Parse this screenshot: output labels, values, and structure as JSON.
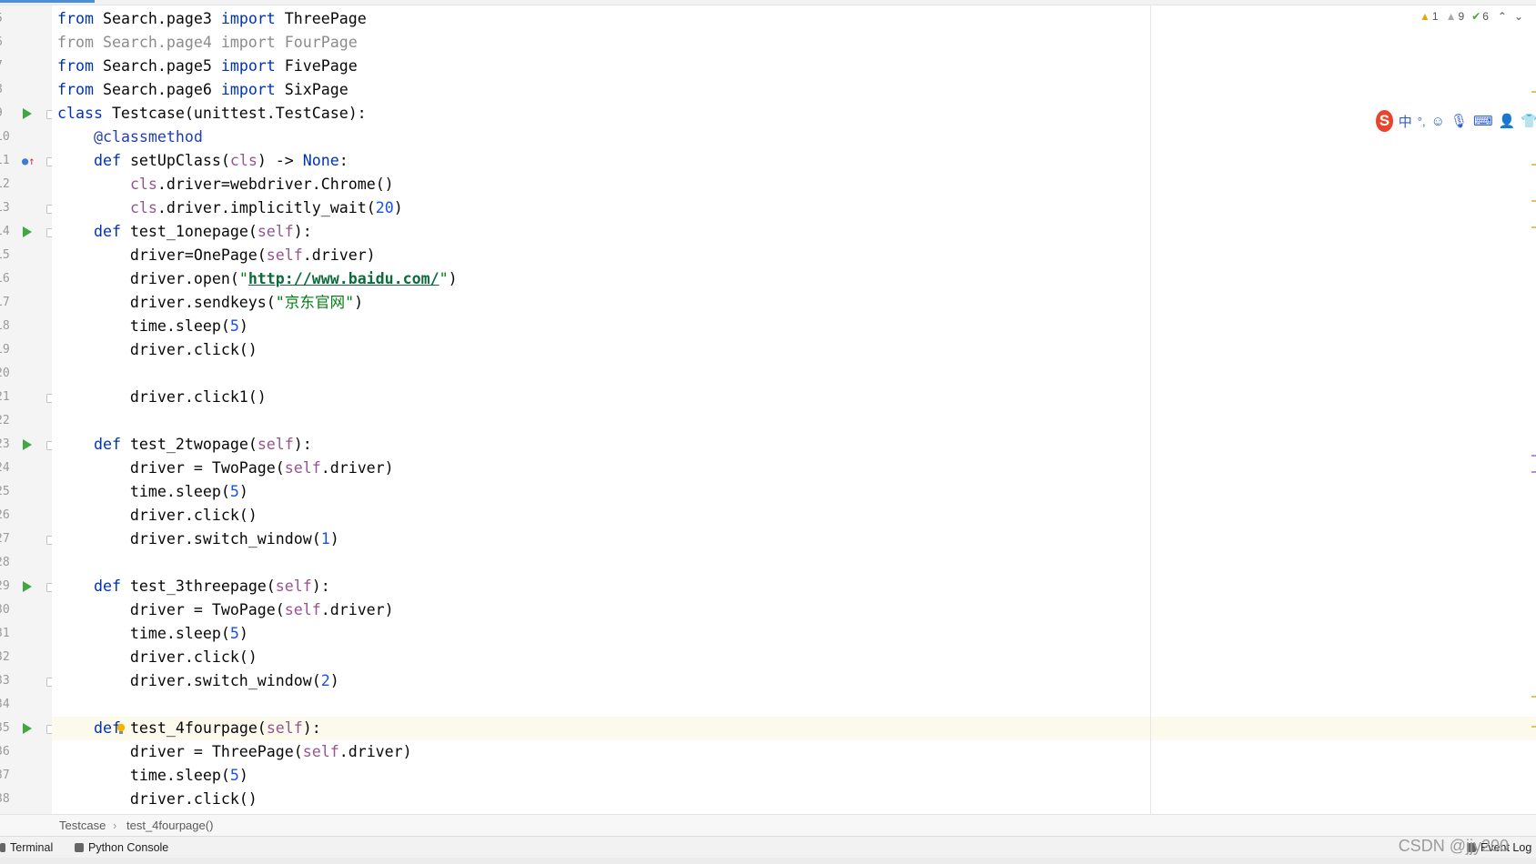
{
  "inspections": {
    "warnings_a": "1",
    "warnings_b": "9",
    "ok_count": "6",
    "prev_icon": "chevron-up-icon",
    "next_icon": "chevron-down-icon"
  },
  "ime_toolbar": {
    "logo": "S",
    "lang": "中",
    "punct": "°,",
    "emoji_icon": "smile-icon",
    "mic_icon": "mic-icon",
    "keyboard_icon": "keyboard-icon",
    "user_icon": "user-icon",
    "skin_icon": "shirt-icon"
  },
  "lines": [
    {
      "n": "5",
      "tokens": [
        {
          "t": "from",
          "c": "k-kw"
        },
        {
          "t": " Search.page3 ",
          "c": ""
        },
        {
          "t": "import",
          "c": "k-kw"
        },
        {
          "t": " ThreePage",
          "c": ""
        }
      ]
    },
    {
      "n": "6",
      "tokens": [
        {
          "t": "from Search.page4 import FourPage",
          "c": "k-gray"
        }
      ]
    },
    {
      "n": "7",
      "tokens": [
        {
          "t": "from",
          "c": "k-kw"
        },
        {
          "t": " Search.page5 ",
          "c": ""
        },
        {
          "t": "import",
          "c": "k-kw"
        },
        {
          "t": " FivePage",
          "c": ""
        }
      ]
    },
    {
      "n": "8",
      "tokens": [
        {
          "t": "from",
          "c": "k-kw"
        },
        {
          "t": " Search.page6 ",
          "c": ""
        },
        {
          "t": "import",
          "c": "k-kw"
        },
        {
          "t": " SixPage",
          "c": ""
        }
      ]
    },
    {
      "n": "9",
      "tokens": [
        {
          "t": "class",
          "c": "k-kw"
        },
        {
          "t": " Testcase(unittest.TestCase):",
          "c": ""
        }
      ]
    },
    {
      "n": "10",
      "tokens": [
        {
          "t": "    ",
          "c": ""
        },
        {
          "t": "@classmethod",
          "c": "k-deco"
        }
      ]
    },
    {
      "n": "11",
      "tokens": [
        {
          "t": "    ",
          "c": ""
        },
        {
          "t": "def",
          "c": "k-def"
        },
        {
          "t": " setUpClass(",
          "c": ""
        },
        {
          "t": "cls",
          "c": "k-self"
        },
        {
          "t": ") -> ",
          "c": ""
        },
        {
          "t": "None",
          "c": "k-kw"
        },
        {
          "t": ":",
          "c": ""
        }
      ]
    },
    {
      "n": "12",
      "tokens": [
        {
          "t": "        ",
          "c": ""
        },
        {
          "t": "cls",
          "c": "k-self"
        },
        {
          "t": ".driver=webdriver.Chrome()",
          "c": ""
        }
      ]
    },
    {
      "n": "13",
      "tokens": [
        {
          "t": "        ",
          "c": ""
        },
        {
          "t": "cls",
          "c": "k-self"
        },
        {
          "t": ".driver.implicitly_wait(",
          "c": ""
        },
        {
          "t": "20",
          "c": "k-num"
        },
        {
          "t": ")",
          "c": ""
        }
      ]
    },
    {
      "n": "14",
      "tokens": [
        {
          "t": "    ",
          "c": ""
        },
        {
          "t": "def",
          "c": "k-def"
        },
        {
          "t": " test_1onepage(",
          "c": ""
        },
        {
          "t": "self",
          "c": "k-self"
        },
        {
          "t": "):",
          "c": ""
        }
      ]
    },
    {
      "n": "15",
      "tokens": [
        {
          "t": "        driver=OnePage(",
          "c": ""
        },
        {
          "t": "self",
          "c": "k-self"
        },
        {
          "t": ".driver)",
          "c": ""
        }
      ]
    },
    {
      "n": "16",
      "tokens": [
        {
          "t": "        driver.open(",
          "c": ""
        },
        {
          "t": "\"",
          "c": "k-str"
        },
        {
          "t": "http://www.baidu.com/",
          "c": "k-link"
        },
        {
          "t": "\"",
          "c": "k-str"
        },
        {
          "t": ")",
          "c": ""
        }
      ]
    },
    {
      "n": "17",
      "tokens": [
        {
          "t": "        driver.sendkeys(",
          "c": ""
        },
        {
          "t": "\"京东官网\"",
          "c": "k-str"
        },
        {
          "t": ")",
          "c": ""
        }
      ]
    },
    {
      "n": "18",
      "tokens": [
        {
          "t": "        time.sleep(",
          "c": ""
        },
        {
          "t": "5",
          "c": "k-num"
        },
        {
          "t": ")",
          "c": ""
        }
      ]
    },
    {
      "n": "19",
      "tokens": [
        {
          "t": "        driver.click()",
          "c": ""
        }
      ]
    },
    {
      "n": "20",
      "tokens": []
    },
    {
      "n": "21",
      "tokens": [
        {
          "t": "        driver.click1()",
          "c": ""
        }
      ]
    },
    {
      "n": "22",
      "tokens": []
    },
    {
      "n": "23",
      "tokens": [
        {
          "t": "    ",
          "c": ""
        },
        {
          "t": "def",
          "c": "k-def"
        },
        {
          "t": " test_2twopage(",
          "c": ""
        },
        {
          "t": "self",
          "c": "k-self"
        },
        {
          "t": "):",
          "c": ""
        }
      ]
    },
    {
      "n": "24",
      "tokens": [
        {
          "t": "        driver = TwoPage(",
          "c": ""
        },
        {
          "t": "self",
          "c": "k-self"
        },
        {
          "t": ".driver)",
          "c": ""
        }
      ]
    },
    {
      "n": "25",
      "tokens": [
        {
          "t": "        time.sleep(",
          "c": ""
        },
        {
          "t": "5",
          "c": "k-num"
        },
        {
          "t": ")",
          "c": ""
        }
      ]
    },
    {
      "n": "26",
      "tokens": [
        {
          "t": "        driver.click()",
          "c": ""
        }
      ]
    },
    {
      "n": "27",
      "tokens": [
        {
          "t": "        driver.switch_window(",
          "c": ""
        },
        {
          "t": "1",
          "c": "k-num"
        },
        {
          "t": ")",
          "c": ""
        }
      ]
    },
    {
      "n": "28",
      "tokens": []
    },
    {
      "n": "29",
      "tokens": [
        {
          "t": "    ",
          "c": ""
        },
        {
          "t": "def",
          "c": "k-def"
        },
        {
          "t": " test_3threepage(",
          "c": ""
        },
        {
          "t": "self",
          "c": "k-self"
        },
        {
          "t": "):",
          "c": ""
        }
      ]
    },
    {
      "n": "30",
      "tokens": [
        {
          "t": "        driver = TwoPage(",
          "c": ""
        },
        {
          "t": "self",
          "c": "k-self"
        },
        {
          "t": ".driver)",
          "c": ""
        }
      ]
    },
    {
      "n": "31",
      "tokens": [
        {
          "t": "        time.sleep(",
          "c": ""
        },
        {
          "t": "5",
          "c": "k-num"
        },
        {
          "t": ")",
          "c": ""
        }
      ]
    },
    {
      "n": "32",
      "tokens": [
        {
          "t": "        driver.click()",
          "c": ""
        }
      ]
    },
    {
      "n": "33",
      "tokens": [
        {
          "t": "        driver.switch_window(",
          "c": ""
        },
        {
          "t": "2",
          "c": "k-num"
        },
        {
          "t": ")",
          "c": ""
        }
      ]
    },
    {
      "n": "34",
      "tokens": []
    },
    {
      "n": "35",
      "tokens": [
        {
          "t": "    ",
          "c": ""
        },
        {
          "t": "def",
          "c": "k-def"
        },
        {
          "t": " test_4fourpage(",
          "c": ""
        },
        {
          "t": "self",
          "c": "k-self"
        },
        {
          "t": "):",
          "c": ""
        }
      ]
    },
    {
      "n": "36",
      "tokens": [
        {
          "t": "        driver = ThreePage(",
          "c": ""
        },
        {
          "t": "self",
          "c": "k-self"
        },
        {
          "t": ".driver)",
          "c": ""
        }
      ]
    },
    {
      "n": "37",
      "tokens": [
        {
          "t": "        time.sleep(",
          "c": ""
        },
        {
          "t": "5",
          "c": "k-num"
        },
        {
          "t": ")",
          "c": ""
        }
      ]
    },
    {
      "n": "38",
      "tokens": [
        {
          "t": "        driver.click()",
          "c": ""
        }
      ]
    }
  ],
  "gutter_icons": [
    {
      "line": "9",
      "icon": "run-icon"
    },
    {
      "line": "11",
      "icon": "override-icon"
    },
    {
      "line": "14",
      "icon": "run-icon"
    },
    {
      "line": "23",
      "icon": "run-icon"
    },
    {
      "line": "29",
      "icon": "run-icon"
    },
    {
      "line": "35",
      "icon": "run-icon"
    }
  ],
  "current_line": "35",
  "breadcrumbs": [
    "Testcase",
    "test_4fourpage()"
  ],
  "bottom_tabs": [
    {
      "label": "Terminal",
      "icon": "terminal-icon"
    },
    {
      "label": "Python Console",
      "icon": "python-console-icon"
    }
  ],
  "event_log": "Event Log",
  "watermark": "CSDN @jjy200"
}
